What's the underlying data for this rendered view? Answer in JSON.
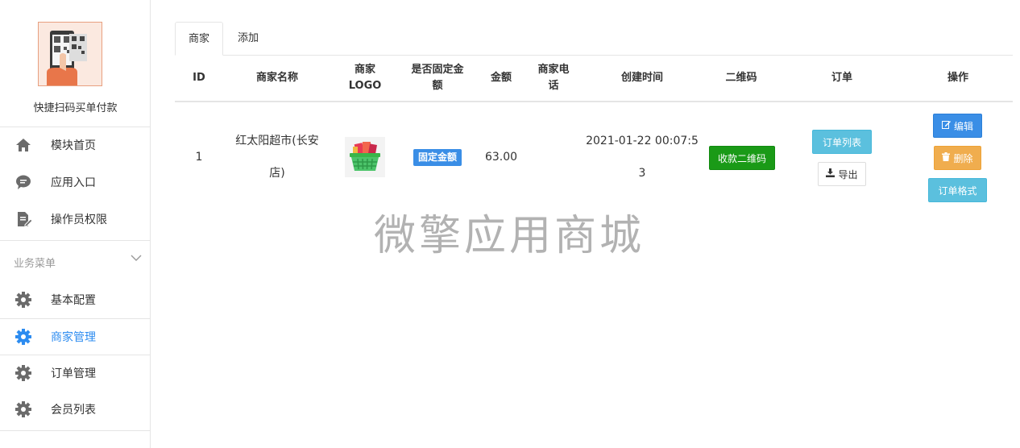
{
  "sidebar": {
    "app_name": "快捷扫码买单付款",
    "top_items": [
      {
        "label": "模块首页",
        "icon": "home-icon"
      },
      {
        "label": "应用入口",
        "icon": "chat-bubble-icon"
      },
      {
        "label": "操作员权限",
        "icon": "edit-document-icon"
      }
    ],
    "section_label": "业务菜单",
    "business_items": [
      {
        "label": "基本配置",
        "icon": "gear-icon",
        "active": false
      },
      {
        "label": "商家管理",
        "icon": "gear-icon",
        "active": true
      },
      {
        "label": "订单管理",
        "icon": "gear-icon",
        "active": false
      },
      {
        "label": "会员列表",
        "icon": "gear-icon",
        "active": false
      }
    ],
    "active_color": "#2d8cf0"
  },
  "tabs": [
    {
      "label": "商家",
      "active": true
    },
    {
      "label": "添加",
      "active": false
    }
  ],
  "table": {
    "headers": {
      "id": "ID",
      "name": "商家名称",
      "logo": "商家\nLOGO",
      "fixed": "是否固定金\n额",
      "amount": "金额",
      "phone": "商家电\n话",
      "created": "创建时间",
      "qrcode": "二维码",
      "orders": "订单",
      "actions": "操作"
    },
    "rows": [
      {
        "id": "1",
        "name": "红太阳超市(长安\n店)",
        "logo_icon": "shopping-basket-icon",
        "fixed_badge": "固定金额",
        "amount": "63.00",
        "phone": "",
        "created": "2021-01-22 00:07:5\n3",
        "qrcode_button": "收款二维码",
        "order_list_button": "订单列表",
        "export_button": "导出",
        "edit_button": "编辑",
        "delete_button": "删除",
        "order_format_button": "订单格式"
      }
    ]
  },
  "watermark": "微擎应用商城",
  "colors": {
    "primary": "#3a8ee6",
    "success": "#1a9a17",
    "info": "#5bc0de",
    "warning": "#f0ad4e"
  }
}
